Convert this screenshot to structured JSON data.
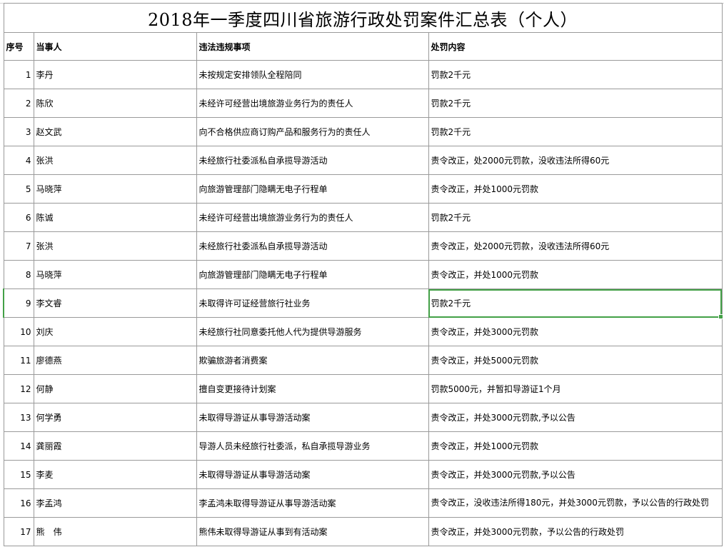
{
  "title": "2018年一季度四川省旅游行政处罚案件汇总表（个人）",
  "headers": {
    "index": "序号",
    "party": "当事人",
    "violation": "违法违规事项",
    "penalty": "处罚内容"
  },
  "rows": [
    {
      "index": "1",
      "party": "李丹",
      "violation": "未按规定安排领队全程陪同",
      "penalty": "罚款2千元"
    },
    {
      "index": "2",
      "party": "陈欣",
      "violation": "未经许可经营出境旅游业务行为的责任人",
      "penalty": "罚款2千元"
    },
    {
      "index": "3",
      "party": "赵文武",
      "violation": "向不合格供应商订购产品和服务行为的责任人",
      "penalty": "罚款2千元"
    },
    {
      "index": "4",
      "party": "张洪",
      "violation": "未经旅行社委派私自承揽导游活动",
      "penalty": "责令改正，处2000元罚款，没收违法所得60元"
    },
    {
      "index": "5",
      "party": "马晓萍",
      "violation": "向旅游管理部门隐瞒无电子行程单",
      "penalty": "责令改正，并处1000元罚款"
    },
    {
      "index": "6",
      "party": "陈诚",
      "violation": "未经许可经营出境旅游业务行为的责任人",
      "penalty": "罚款2千元"
    },
    {
      "index": "7",
      "party": "张洪",
      "violation": "未经旅行社委派私自承揽导游活动",
      "penalty": "责令改正，处2000元罚款，没收违法所得60元"
    },
    {
      "index": "8",
      "party": "马晓萍",
      "violation": "向旅游管理部门隐瞒无电子行程单",
      "penalty": "责令改正，并处1000元罚款"
    },
    {
      "index": "9",
      "party": "李文睿",
      "violation": "未取得许可证经营旅行社业务",
      "penalty": "罚款2千元"
    },
    {
      "index": "10",
      "party": "刘庆",
      "violation": "未经旅行社同意委托他人代为提供导游服务",
      "penalty": "责令改正，并处3000元罚款"
    },
    {
      "index": "11",
      "party": "廖德燕",
      "violation": "欺骗旅游者消费案",
      "penalty": "责令改正，并处5000元罚款"
    },
    {
      "index": "12",
      "party": "何静",
      "violation": "擅自变更接待计划案",
      "penalty": "罚款5000元，并暂扣导游证1个月"
    },
    {
      "index": "13",
      "party": "何学勇",
      "violation": "未取得导游证从事导游活动案",
      "penalty": "责令改正，并处3000元罚款,予以公告"
    },
    {
      "index": "14",
      "party": "龚丽霞",
      "violation": "导游人员未经旅行社委派，私自承揽导游业务",
      "penalty": "责令改正，并处1000元罚款"
    },
    {
      "index": "15",
      "party": "李麦",
      "violation": "未取得导游证从事导游活动案",
      "penalty": "责令改正，并处3000元罚款,予以公告"
    },
    {
      "index": "16",
      "party": "李孟鸿",
      "violation": "李孟鸿未取得导游证从事导游活动案",
      "penalty": "责令改正，没收违法所得180元，并处3000元罚款，予以公告的行政处罚"
    },
    {
      "index": "17",
      "party": "熊　伟",
      "violation": "熊伟未取得导游证从事到有活动案",
      "penalty": "责令改正，并处3000元罚款，予以公告的行政处罚"
    }
  ],
  "selected_row_index": "9",
  "accent_color": "#43a047"
}
